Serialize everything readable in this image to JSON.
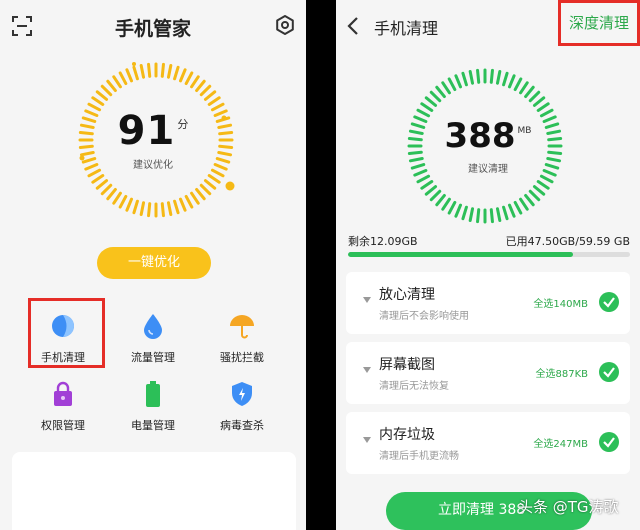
{
  "left": {
    "title": "手机管家",
    "score": "91",
    "score_unit": "分",
    "score_sub": "建议优化",
    "optimize_label": "一键优化",
    "grid": [
      {
        "label": "手机清理",
        "icon": "leaf-circle-icon"
      },
      {
        "label": "流量管理",
        "icon": "water-drop-icon"
      },
      {
        "label": "骚扰拦截",
        "icon": "umbrella-icon"
      },
      {
        "label": "权限管理",
        "icon": "lock-icon"
      },
      {
        "label": "电量管理",
        "icon": "battery-icon"
      },
      {
        "label": "病毒查杀",
        "icon": "shield-icon"
      }
    ],
    "gauge_color": "#f5b915"
  },
  "right": {
    "title": "手机清理",
    "deep_clean_label": "深度清理",
    "junk_size": "388",
    "junk_unit": "MB",
    "junk_sub": "建议清理",
    "storage_free": "剩余12.09GB",
    "storage_used": "已用47.50GB/59.59 GB",
    "storage_used_fraction": 0.797,
    "items": [
      {
        "title": "放心清理",
        "desc": "清理后不会影响使用",
        "select": "全选140MB"
      },
      {
        "title": "屏幕截图",
        "desc": "清理后无法恢复",
        "select": "全选887KB"
      },
      {
        "title": "内存垃圾",
        "desc": "清理后手机更流畅",
        "select": "全选247MB"
      }
    ],
    "clean_now_label": "立即清理 388",
    "gauge_color": "#2cbf58"
  },
  "watermark": "头条 @TG涛歌"
}
